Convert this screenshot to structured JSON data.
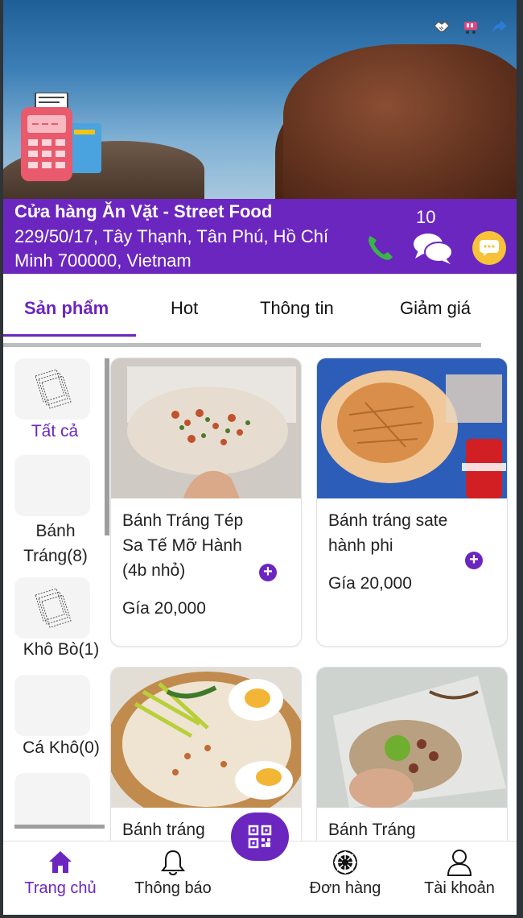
{
  "store": {
    "name": "Cửa hàng Ăn Vặt - Street Food",
    "address": "229/50/17, Tây Thạnh, Tân Phú, Hồ Chí Minh 700000, Vietnam",
    "chat_count": "10"
  },
  "tabs": [
    {
      "label": "Sản phẩm",
      "active": true
    },
    {
      "label": "Hot"
    },
    {
      "label": "Thông tin"
    },
    {
      "label": "Giảm giá"
    }
  ],
  "categories": [
    {
      "label": "Tất cả",
      "icon": "papers-icon",
      "active": true
    },
    {
      "label": "Bánh Tráng(8)"
    },
    {
      "label": "Khô Bò(1)",
      "icon": "papers-icon"
    },
    {
      "label": "Cá Khô(0)"
    },
    {
      "label": ""
    }
  ],
  "products": [
    {
      "name": "Bánh Tráng Tép Sa Tế Mỡ Hành (4b nhỏ)",
      "price": "Gía 20,000",
      "add": "+"
    },
    {
      "name": "Bánh tráng sate hành phi",
      "price": "Gía 20,000",
      "add": "+"
    },
    {
      "name": "Bánh tráng",
      "price": "",
      "partial": "Bánh tráng"
    },
    {
      "name": "Bánh Tráng",
      "price": "",
      "partial": "Bánh Tráng"
    }
  ],
  "bottom_nav": [
    {
      "label": "Trang chủ",
      "icon": "home-icon",
      "active": true
    },
    {
      "label": "Thông báo",
      "icon": "bell-icon"
    },
    {
      "label": "Đơn hàng",
      "icon": "order-icon"
    },
    {
      "label": "Tài khoản",
      "icon": "user-icon"
    }
  ],
  "colors": {
    "primary": "#6b26c0",
    "chat_bubble": "#f7c23a",
    "phone_icon": "#3ab54a"
  }
}
